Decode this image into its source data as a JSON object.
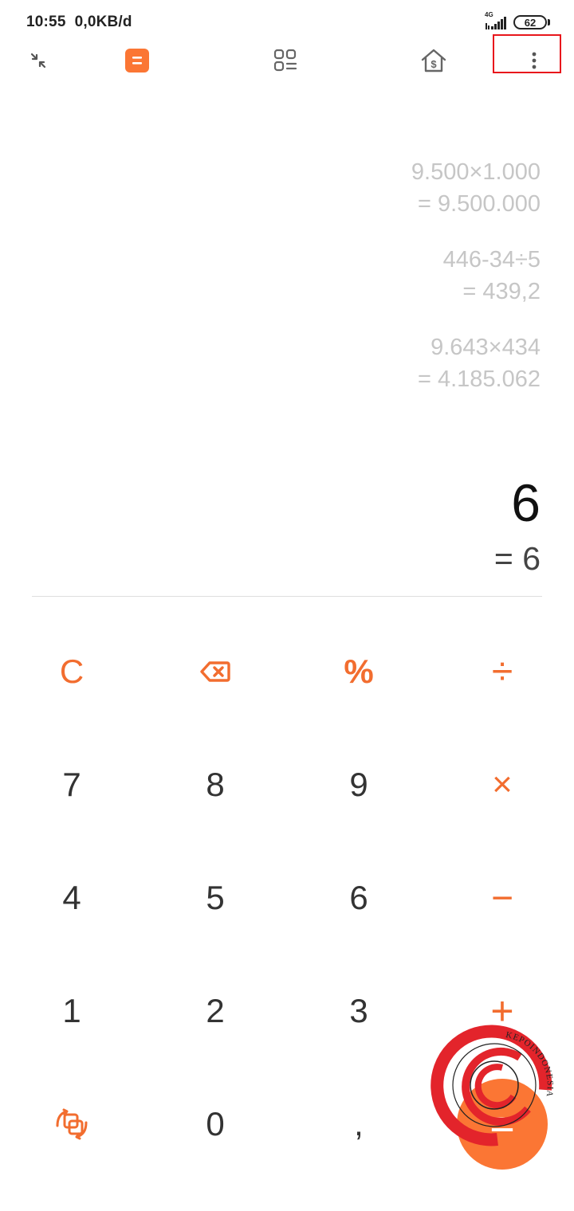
{
  "status_bar": {
    "time": "10:55",
    "data_speed": "0,0KB/d",
    "network_type": "4G",
    "battery_level": "62"
  },
  "toolbar": {
    "icons": [
      "collapse-icon",
      "calculator-icon",
      "converter-grid-icon",
      "currency-house-icon",
      "more-options-icon"
    ],
    "accent_color": "#fb7634"
  },
  "history": [
    {
      "expression": "9.500×1.000",
      "result": "= 9.500.000"
    },
    {
      "expression": "446-34÷5",
      "result": "= 439,2"
    },
    {
      "expression": "9.643×434",
      "result": "= 4.185.062"
    }
  ],
  "current": {
    "expression": "6",
    "result": "= 6"
  },
  "keypad": {
    "row1": {
      "clear": "C",
      "backspace_icon": "backspace-icon",
      "percent": "%",
      "divide": "÷"
    },
    "row2": {
      "seven": "7",
      "eight": "8",
      "nine": "9",
      "multiply": "×"
    },
    "row3": {
      "four": "4",
      "five": "5",
      "six": "6",
      "minus": "−"
    },
    "row4": {
      "one": "1",
      "two": "2",
      "three": "3",
      "plus": "+"
    },
    "row5": {
      "toggle_icon": "swap-mode-icon",
      "zero": "0",
      "comma": ",",
      "equals": "="
    }
  },
  "watermark": {
    "text": "KEPOINDONESIA"
  }
}
